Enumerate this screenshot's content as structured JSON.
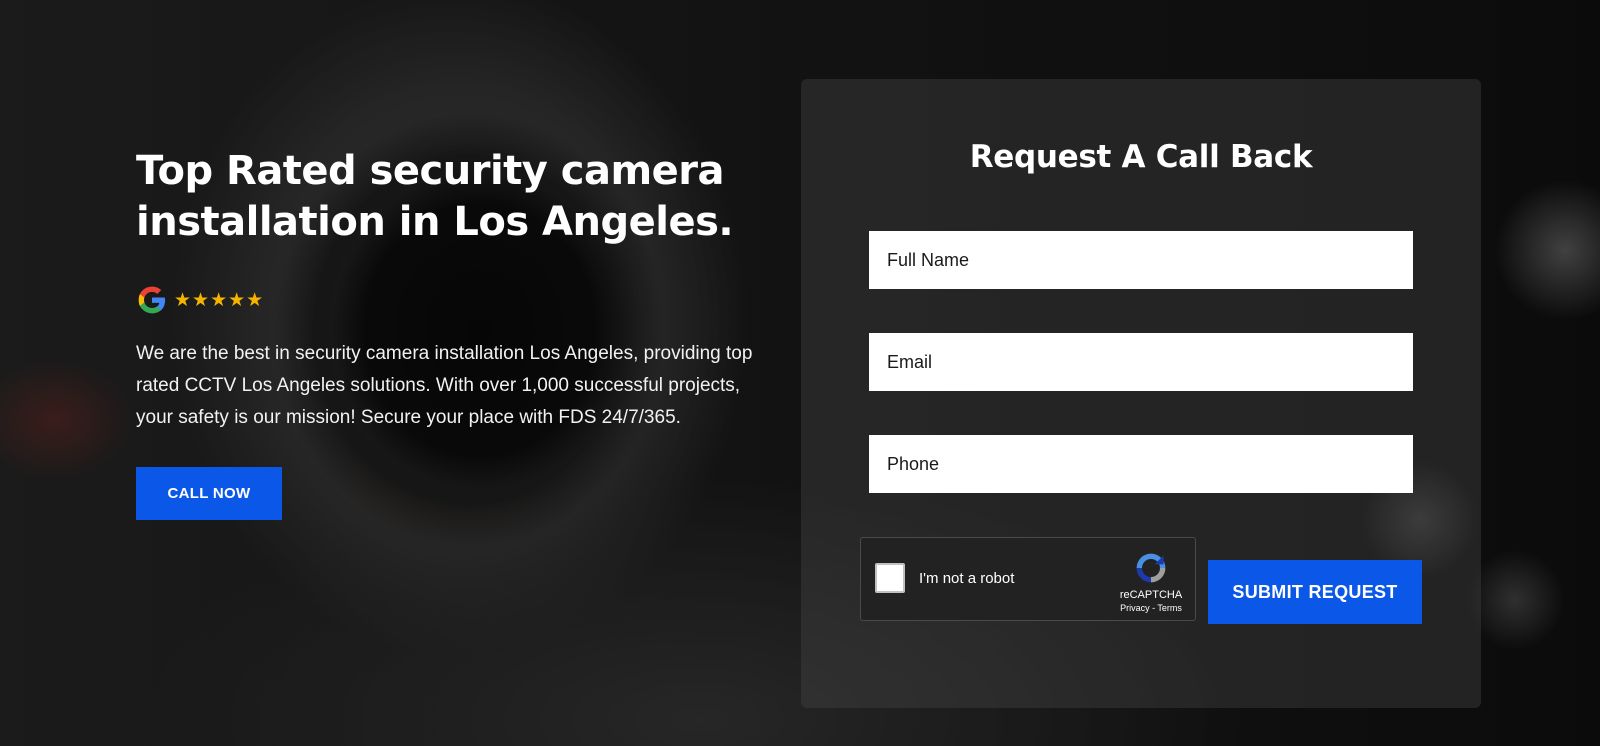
{
  "hero": {
    "title": "Top Rated security camera installation in Los Angeles.",
    "stars": "★★★★★",
    "description": "We are the best in security camera installation Los Angeles, providing top rated CCTV Los Angeles solutions. With over 1,000 successful projects, your safety is our mission! Secure your place with FDS 24/7/365.",
    "call_button": "CALL NOW",
    "rating_icon": "google-g-icon"
  },
  "form": {
    "title": "Request A Call Back",
    "fields": [
      {
        "placeholder": "Full Name",
        "value": ""
      },
      {
        "placeholder": "Email",
        "value": ""
      },
      {
        "placeholder": "Phone",
        "value": ""
      }
    ],
    "recaptcha": {
      "label": "I'm not a robot",
      "brand": "reCAPTCHA",
      "links": "Privacy - Terms",
      "checked": false
    },
    "submit_button": "SUBMIT REQUEST"
  },
  "colors": {
    "accent": "#0b57e8",
    "stars": "#f4b400"
  }
}
